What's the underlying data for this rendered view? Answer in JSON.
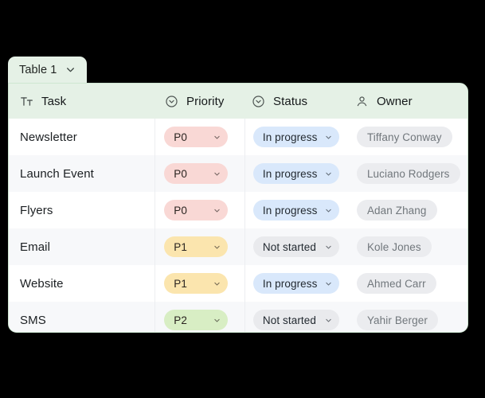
{
  "tab": {
    "label": "Table 1",
    "chevron_icon": "chevron-down-icon",
    "background": "#e5f1e6"
  },
  "table": {
    "header_background": "#e5f1e6",
    "border_color": "#cfe7d2",
    "row_alt_background": "#f7f8fa",
    "columns": [
      {
        "label": "Task",
        "icon": "text-format-icon",
        "key": "task"
      },
      {
        "label": "Priority",
        "icon": "select-circle-icon",
        "key": "priority"
      },
      {
        "label": "Status",
        "icon": "select-circle-icon",
        "key": "status"
      },
      {
        "label": "Owner",
        "icon": "person-icon",
        "key": "owner"
      }
    ],
    "rows": [
      {
        "task": "Newsletter",
        "priority": "P0",
        "status": "In progress",
        "owner": "Tiffany Conway"
      },
      {
        "task": "Launch Event",
        "priority": "P0",
        "status": "In progress",
        "owner": "Luciano Rodgers"
      },
      {
        "task": "Flyers",
        "priority": "P0",
        "status": "In progress",
        "owner": "Adan Zhang"
      },
      {
        "task": "Email",
        "priority": "P1",
        "status": "Not started",
        "owner": "Kole Jones"
      },
      {
        "task": "Website",
        "priority": "P1",
        "status": "In progress",
        "owner": "Ahmed Carr"
      },
      {
        "task": "SMS",
        "priority": "P2",
        "status": "Not started",
        "owner": "Yahir Berger"
      }
    ],
    "priority_colors": {
      "P0": {
        "background": "#f9d8d5",
        "text": "#2a2420"
      },
      "P1": {
        "background": "#fbe5ae",
        "text": "#2a2420"
      },
      "P2": {
        "background": "#d8eec4",
        "text": "#2a2420"
      }
    },
    "status_colors": {
      "In progress": {
        "background": "#d9e8fb",
        "text": "#232a31"
      },
      "Not started": {
        "background": "#e9eaed",
        "text": "#232a31"
      }
    },
    "owner_pill": {
      "background": "#ebecef",
      "text": "#71777c"
    }
  }
}
